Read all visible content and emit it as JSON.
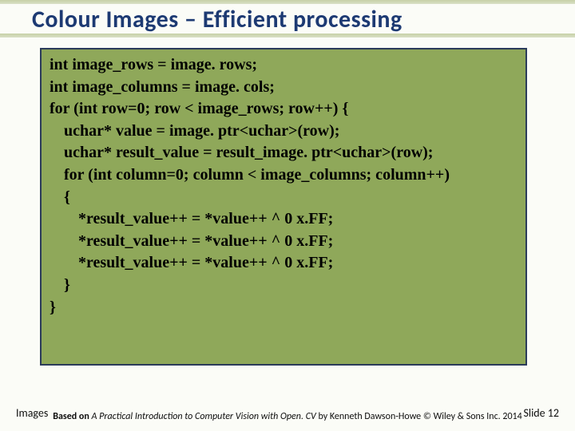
{
  "title": "Colour Images – Efficient processing",
  "code": {
    "lines": [
      {
        "indent": 1,
        "text": "int image_rows = image. rows;"
      },
      {
        "indent": 1,
        "text": "int image_columns = image. cols;"
      },
      {
        "indent": 1,
        "text": "for (int row=0; row < image_rows; row++) {"
      },
      {
        "indent": 2,
        "text": "uchar* value = image. ptr<uchar>(row);"
      },
      {
        "indent": 2,
        "text": "uchar* result_value = result_image. ptr<uchar>(row);"
      },
      {
        "indent": 2,
        "text": "for (int column=0; column < image_columns; column++)"
      },
      {
        "indent": 2,
        "text": "{"
      },
      {
        "indent": 3,
        "text": "*result_value++ = *value++ ^ 0 x.FF;"
      },
      {
        "indent": 3,
        "text": "*result_value++ = *value++ ^ 0 x.FF;"
      },
      {
        "indent": 3,
        "text": "*result_value++ = *value++ ^ 0 x.FF;"
      },
      {
        "indent": 2,
        "text": "}"
      },
      {
        "indent": 1,
        "text": "}"
      }
    ]
  },
  "footer": {
    "left": "Images",
    "center_prefix": "Based on ",
    "center_title": "A Practical Introduction to Computer Vision with Open. CV",
    "center_suffix": " by Kenneth Dawson-Howe © Wiley & Sons Inc. 2014",
    "right": "Slide 12"
  }
}
